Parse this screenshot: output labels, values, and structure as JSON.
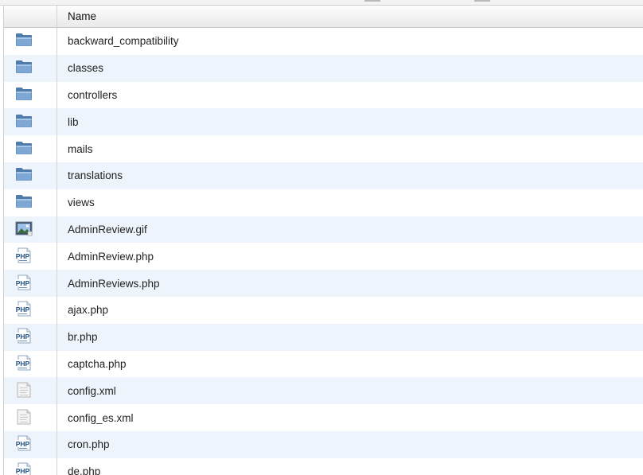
{
  "table": {
    "column_name_label": "Name",
    "rows": [
      {
        "name": "backward_compatibility",
        "icon": "folder-icon"
      },
      {
        "name": "classes",
        "icon": "folder-icon"
      },
      {
        "name": "controllers",
        "icon": "folder-icon"
      },
      {
        "name": "lib",
        "icon": "folder-icon"
      },
      {
        "name": "mails",
        "icon": "folder-icon"
      },
      {
        "name": "translations",
        "icon": "folder-icon"
      },
      {
        "name": "views",
        "icon": "folder-icon"
      },
      {
        "name": "AdminReview.gif",
        "icon": "image-file-icon"
      },
      {
        "name": "AdminReview.php",
        "icon": "php-file-icon"
      },
      {
        "name": "AdminReviews.php",
        "icon": "php-file-icon"
      },
      {
        "name": "ajax.php",
        "icon": "php-file-icon"
      },
      {
        "name": "br.php",
        "icon": "php-file-icon"
      },
      {
        "name": "captcha.php",
        "icon": "php-file-icon"
      },
      {
        "name": "config.xml",
        "icon": "text-file-icon"
      },
      {
        "name": "config_es.xml",
        "icon": "text-file-icon"
      },
      {
        "name": "cron.php",
        "icon": "php-file-icon"
      },
      {
        "name": "de.php",
        "icon": "php-file-icon"
      }
    ]
  }
}
